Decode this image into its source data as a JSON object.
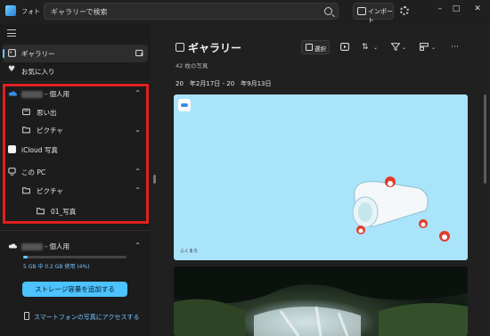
{
  "window": {
    "app_title": "フォト",
    "search_placeholder": "ギャラリーで検索",
    "import_label": "インポート",
    "controls": [
      "–",
      "□",
      "✕"
    ]
  },
  "sidebar": {
    "items": [
      {
        "label": "ギャラリー",
        "icon": "gallery-icon",
        "active": true
      },
      {
        "label": "お気に入り",
        "icon": "heart-icon"
      }
    ],
    "onedrive_personal": {
      "suffix": "- 個人用",
      "icon": "cloud-icon"
    },
    "onedrive_children": [
      {
        "label": "思い出",
        "icon": "memories-icon"
      },
      {
        "label": "ピクチャ",
        "icon": "folder-icon"
      }
    ],
    "icloud": {
      "label": "iCloud 写真",
      "icon": "icloud-icon"
    },
    "this_pc": {
      "label": "この PC",
      "icon": "pc-icon"
    },
    "pc_children": [
      {
        "label": "ピクチャ",
        "icon": "folder-icon"
      },
      {
        "label": "01_写真",
        "icon": "folder-icon"
      }
    ],
    "storage": {
      "account_suffix": "- 個人用",
      "usage_text": "5 GB 中 0.2 GB 使用 (4%)",
      "usage_fraction": 0.04,
      "add_button": "ストレージ容量を追加する"
    },
    "phone_link": "スマートフォンの写真にアクセスする"
  },
  "main": {
    "title": "ギャラリー",
    "count": "42 枚の写真",
    "select_label": "選択",
    "date_range": "20　年2月17日 - 20　年9月13日",
    "photo1_caption": "ふくまろ",
    "colors": {
      "accent": "#60cdff",
      "highlight": "#e0201f"
    }
  }
}
